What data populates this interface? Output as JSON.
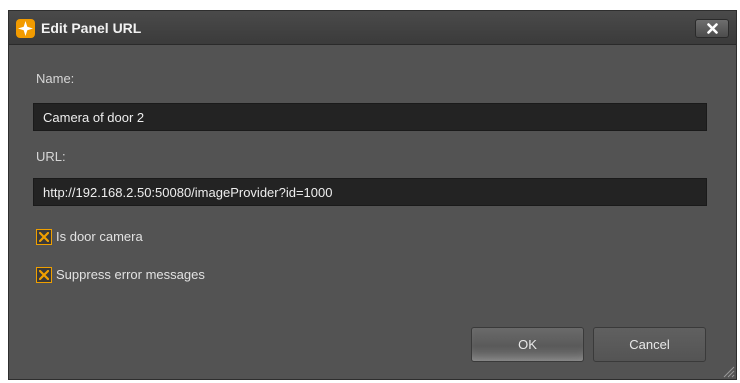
{
  "window": {
    "title": "Edit Panel URL",
    "close_glyph": "✕",
    "icons": {
      "app": "app-logo-icon",
      "close": "close-icon",
      "resize": "resize-grip-icon"
    }
  },
  "form": {
    "name_label": "Name:",
    "name_value": "Camera of door 2",
    "url_label": "URL:",
    "url_value": "http://192.168.2.50:50080/imageProvider?id=1000",
    "checkboxes": [
      {
        "label": "Is door camera",
        "checked": true
      },
      {
        "label": "Suppress error messages",
        "checked": true
      }
    ]
  },
  "buttons": {
    "ok_label": "OK",
    "cancel_label": "Cancel"
  },
  "colors": {
    "accent": "#f0a000",
    "dialog_bg": "#535353",
    "input_bg": "#232323"
  }
}
